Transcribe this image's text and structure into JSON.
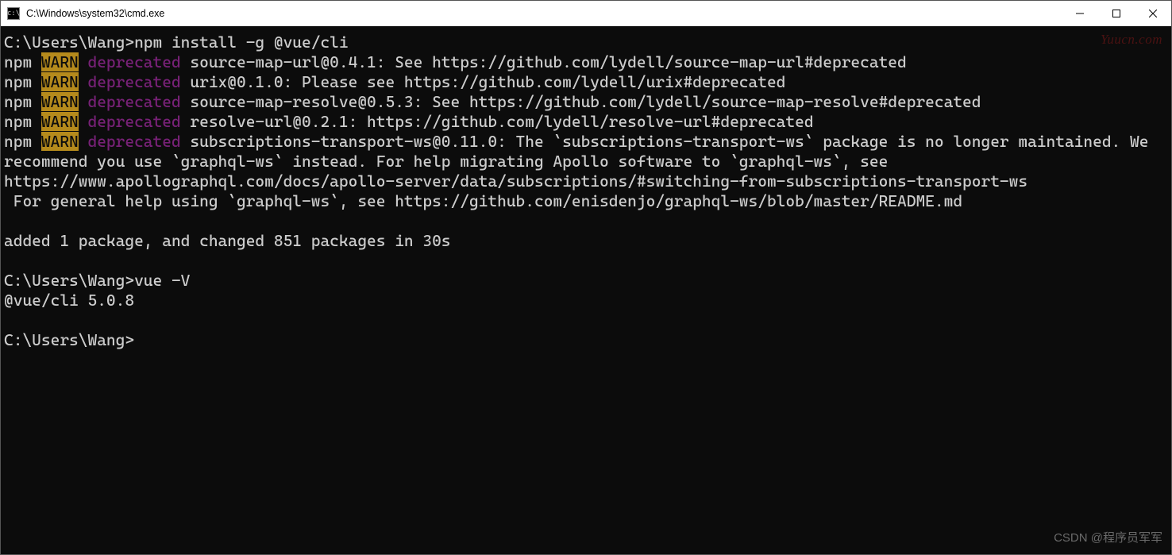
{
  "window": {
    "title": "C:\\Windows\\system32\\cmd.exe",
    "icon_label": "cmd"
  },
  "terminal": {
    "blank_top": "",
    "prompt1": "C:\\Users\\Wang>npm install -g @vue/cli",
    "warn_lines": [
      {
        "npm": "npm ",
        "warn": "WARN",
        "dep": " deprecated",
        "msg": " source-map-url@0.4.1: See https://github.com/lydell/source-map-url#deprecated"
      },
      {
        "npm": "npm ",
        "warn": "WARN",
        "dep": " deprecated",
        "msg": " urix@0.1.0: Please see https://github.com/lydell/urix#deprecated"
      },
      {
        "npm": "npm ",
        "warn": "WARN",
        "dep": " deprecated",
        "msg": " source-map-resolve@0.5.3: See https://github.com/lydell/source-map-resolve#deprecated"
      },
      {
        "npm": "npm ",
        "warn": "WARN",
        "dep": " deprecated",
        "msg": " resolve-url@0.2.1: https://github.com/lydell/resolve-url#deprecated"
      },
      {
        "npm": "npm ",
        "warn": "WARN",
        "dep": " deprecated",
        "msg": " subscriptions-transport-ws@0.11.0: The `subscriptions-transport-ws` package is no longer maintained. We recommend you use `graphql-ws` instead. For help migrating Apollo software to `graphql-ws`, see https://www.apollographql.com/docs/apollo-server/data/subscriptions/#switching-from-subscriptions-transport-ws\n For general help using `graphql-ws`, see https://github.com/enisdenjo/graphql-ws/blob/master/README.md"
      }
    ],
    "added_line": "added 1 package, and changed 851 packages in 30s",
    "prompt2": "C:\\Users\\Wang>vue -V",
    "vue_version": "@vue/cli 5.0.8",
    "prompt3": "C:\\Users\\Wang>"
  },
  "watermarks": {
    "tr": "Yuucn.com",
    "br": "CSDN @程序员军军"
  }
}
